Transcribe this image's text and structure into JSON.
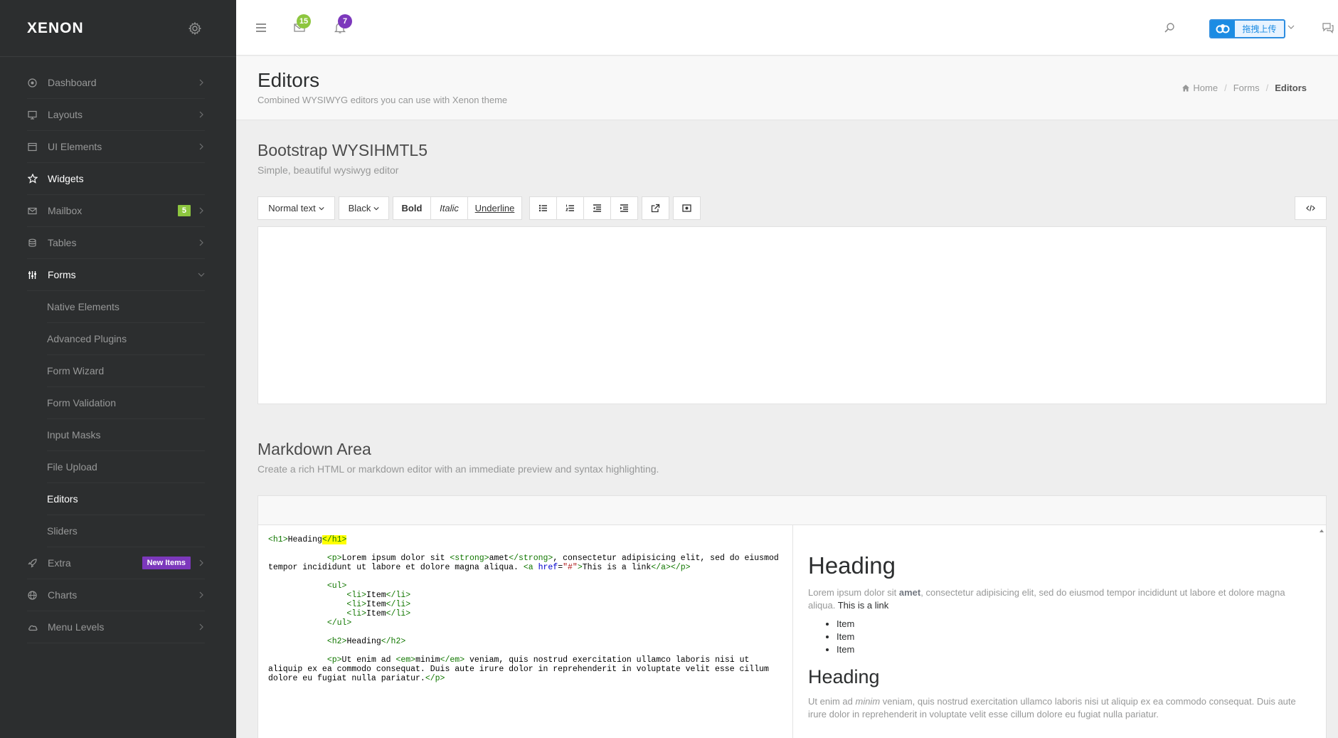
{
  "sidebar": {
    "logo": "XENON",
    "items": [
      {
        "label": "Dashboard",
        "icon": "dashboard-icon"
      },
      {
        "label": "Layouts",
        "icon": "monitor-icon"
      },
      {
        "label": "UI Elements",
        "icon": "window-icon"
      },
      {
        "label": "Widgets",
        "icon": "star-icon"
      },
      {
        "label": "Mailbox",
        "icon": "mail-icon",
        "badge": "5"
      },
      {
        "label": "Tables",
        "icon": "database-icon"
      },
      {
        "label": "Forms",
        "icon": "sliders-icon"
      },
      {
        "label": "Extra",
        "icon": "rocket-icon",
        "badge": "New Items"
      },
      {
        "label": "Charts",
        "icon": "globe-icon"
      },
      {
        "label": "Menu Levels",
        "icon": "cloud-icon"
      }
    ],
    "forms_sub": [
      "Native Elements",
      "Advanced Plugins",
      "Form Wizard",
      "Form Validation",
      "Input Masks",
      "File Upload",
      "Editors",
      "Sliders"
    ]
  },
  "topbar": {
    "messages_count": "15",
    "notifications_count": "7",
    "upload_label": "拖拽上传"
  },
  "page": {
    "title": "Editors",
    "description": "Combined WYSIWYG editors you can use with Xenon theme",
    "breadcrumb": {
      "home": "Home",
      "forms": "Forms",
      "current": "Editors"
    }
  },
  "wysihtml": {
    "title": "Bootstrap WYSIHMTL5",
    "description": "Simple, beautiful wysiwyg editor",
    "toolbar": {
      "text_style": "Normal text",
      "color": "Black",
      "bold": "Bold",
      "italic": "Italic",
      "underline": "Underline"
    }
  },
  "markdown": {
    "title": "Markdown Area",
    "description": "Create a rich HTML or markdown editor with an immediate preview and syntax highlighting.",
    "code": {
      "h1_open": "<h1>",
      "h1_text": "Heading",
      "h1_close": "</h1>",
      "p1_open": "<p>",
      "p1_text_a": "Lorem ipsum dolor sit ",
      "strong_open": "<strong>",
      "strong_text": "amet",
      "strong_close": "</strong>",
      "p1_text_b": ", consectetur adipisicing elit, sed do eiusmod tempor incididunt ut labore et dolore magna aliqua. ",
      "a_open_a": "<a ",
      "a_attr": "href",
      "a_eq": "=",
      "a_val": "\"#\"",
      "a_open_b": ">",
      "a_text": "This is a link",
      "a_close": "</a></p>",
      "ul_open": "<ul>",
      "li_open": "<li>",
      "li_text": "Item",
      "li_close": "</li>",
      "ul_close": "</ul>",
      "h2_open": "<h2>",
      "h2_text": "Heading",
      "h2_close": "</h2>",
      "p2_open": "<p>",
      "p2_text_a": "Ut enim ad ",
      "em_open": "<em>",
      "em_text": "minim",
      "em_close": "</em>",
      "p2_text_b": " veniam, quis nostrud exercitation ullamco laboris nisi ut aliquip ex ea commodo consequat. Duis aute irure dolor in reprehenderit in voluptate velit esse cillum dolore eu fugiat nulla pariatur.",
      "p2_close": "</p>"
    },
    "preview": {
      "h1": "Heading",
      "p1_a": "Lorem ipsum dolor sit ",
      "p1_strong": "amet",
      "p1_b": ", consectetur adipisicing elit, sed do eiusmod tempor incididunt ut labore et dolore magna aliqua. ",
      "p1_link": "This is a link",
      "items": [
        "Item",
        "Item",
        "Item"
      ],
      "h2": "Heading",
      "p2_a": "Ut enim ad ",
      "p2_em": "minim",
      "p2_b": " veniam, quis nostrud exercitation ullamco laboris nisi ut aliquip ex ea commodo consequat. Duis aute irure dolor in reprehenderit in voluptate velit esse cillum dolore eu fugiat nulla pariatur."
    }
  },
  "colors": {
    "sidebar_bg": "#2c2e2f",
    "accent_green": "#8dc63f",
    "accent_purple": "#7c38bc",
    "upload_blue": "#1c8ce3"
  }
}
